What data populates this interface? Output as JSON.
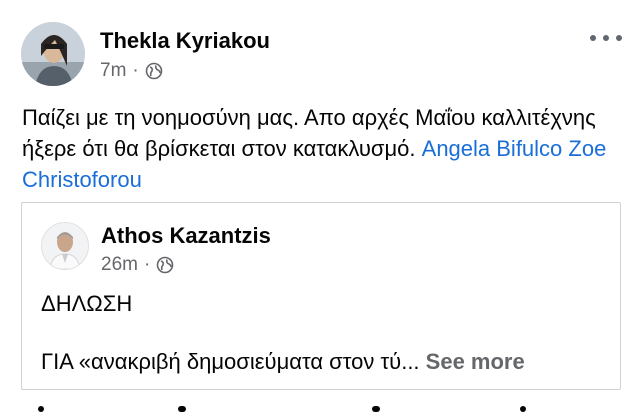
{
  "post": {
    "author": "Thekla Kyriakou",
    "time": "7m",
    "dot": "·",
    "privacy_icon": "globe-icon",
    "text": "Παίζει με τη νοημοσύνη μας. Απο αρχές Μαΐου καλλιτέχνης ήξερε ότι θα βρίσκεται στον κατακλυσμό.",
    "mention": "Angela Bifulco Zoe Christoforou",
    "menu_icon": "more-options-icon"
  },
  "shared_post": {
    "author": "Athos Kazantzis",
    "time": "26m",
    "dot": "·",
    "privacy_icon": "globe-icon",
    "line1": "ΔΗΛΩΣΗ",
    "line2": "ΓΙΑ «ανακριβή δημοσιεύματα στον τύ...",
    "see_more": "See more"
  },
  "colors": {
    "mention": "#1a6ed8",
    "meta": "#65676b",
    "text": "#050505"
  }
}
